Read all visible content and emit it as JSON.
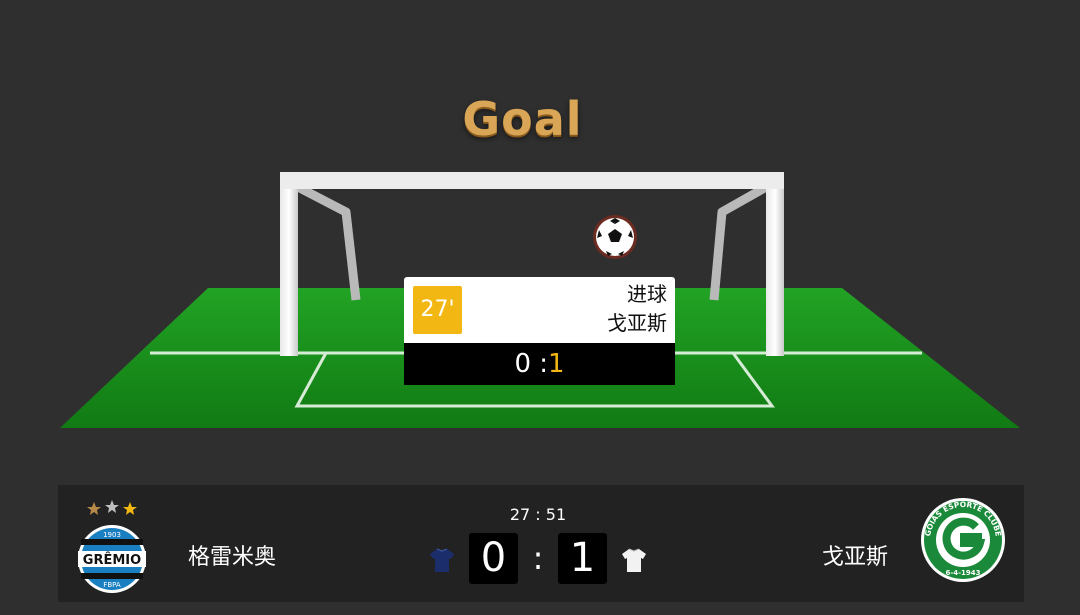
{
  "title": "Goal",
  "event": {
    "minute": "27'",
    "type": "进球",
    "team": "戈亚斯",
    "score_home": "0",
    "score_sep": ":",
    "score_away": "1"
  },
  "match": {
    "clock": "27 : 51",
    "home": {
      "name": "格雷米奥",
      "score": "0",
      "logo_text": "GRÊMIO",
      "logo_year": "1903",
      "logo_sub": "FBPA",
      "kit_color": "#1c2d6b"
    },
    "away": {
      "name": "戈亚斯",
      "score": "1",
      "logo_ring_text": "GOIÁS ESPORTE CLUBE",
      "logo_date": "6-4-1943",
      "kit_color": "#f2f2f2"
    },
    "separator": ":"
  },
  "colors": {
    "background": "#2f2f2f",
    "title": "#d9a556",
    "accent": "#f2b712",
    "pitch": "#1f8a1f",
    "away_brand": "#1a8a3a",
    "home_brand": "#1a7fc1"
  },
  "icons": {
    "ball": "soccer-ball-icon",
    "home_kit": "home-jersey-icon",
    "away_kit": "away-jersey-icon"
  }
}
